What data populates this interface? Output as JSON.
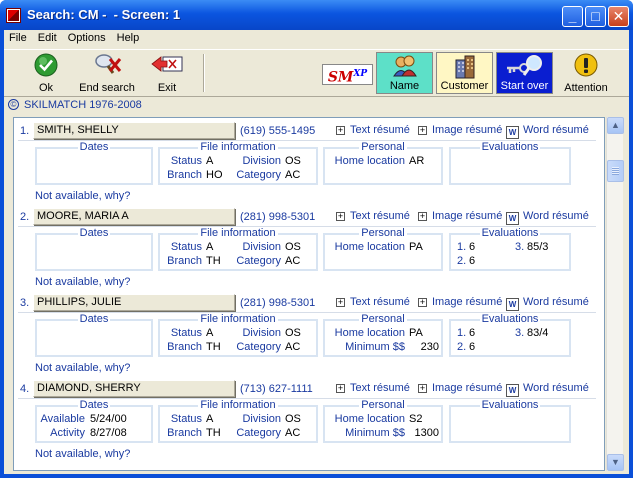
{
  "window": {
    "title": "Search: CM -  - Screen: 1",
    "controls": {
      "minimize": "_",
      "maximize": "□",
      "close": "✕"
    }
  },
  "menu": [
    "File",
    "Edit",
    "Options",
    "Help"
  ],
  "toolbar": {
    "ok": {
      "label": "Ok",
      "icon": "ok-check-icon"
    },
    "end_search": {
      "label": "End search",
      "icon": "end-search-icon"
    },
    "exit": {
      "label": "Exit",
      "icon": "exit-icon"
    },
    "logo": {
      "text": "SM",
      "sup": "XP"
    },
    "name": {
      "label": "Name",
      "icon": "people-icon",
      "color": "#5de0c8"
    },
    "customer": {
      "label": "Customer",
      "icon": "building-icon",
      "color": "#fff7c4"
    },
    "start_over": {
      "label": "Start over",
      "icon": "search-key-icon",
      "color": "#0a1ed0"
    },
    "attention": {
      "label": "Attention",
      "icon": "attention-icon"
    }
  },
  "copyright": "SKILMATCH 1976-2008",
  "links": {
    "text_resume": "Text résumé",
    "image_resume": "Image résumé",
    "word_resume": "Word résumé",
    "not_available": "Not available, why?"
  },
  "panels": {
    "dates": "Dates",
    "file_information": "File information",
    "personal": "Personal",
    "evaluations": "Evaluations"
  },
  "field_labels": {
    "status": "Status",
    "branch": "Branch",
    "division": "Division",
    "category": "Category",
    "home_location": "Home location",
    "minimum": "Minimum $$",
    "available": "Available",
    "activity": "Activity"
  },
  "records": [
    {
      "num": "1.",
      "name": "SMITH, SHELLY",
      "phone": "(619) 555-1495",
      "status": "A",
      "branch": "HO",
      "division": "OS",
      "category": "AC",
      "home_location": "AR",
      "minimum": "",
      "available": "",
      "activity": "",
      "evals": []
    },
    {
      "num": "2.",
      "name": "MOORE, MARIA A",
      "phone": "(281) 998-5301",
      "status": "A",
      "branch": "TH",
      "division": "OS",
      "category": "AC",
      "home_location": "PA",
      "minimum": "",
      "available": "",
      "activity": "",
      "evals": [
        {
          "n": "1.",
          "v": "6"
        },
        {
          "n": "3.",
          "v": "85/3"
        },
        {
          "n": "2.",
          "v": "6"
        }
      ]
    },
    {
      "num": "3.",
      "name": "PHILLIPS, JULIE",
      "phone": "(281) 998-5301",
      "status": "A",
      "branch": "TH",
      "division": "OS",
      "category": "AC",
      "home_location": "PA",
      "minimum": "230",
      "available": "",
      "activity": "",
      "evals": [
        {
          "n": "1.",
          "v": "6"
        },
        {
          "n": "3.",
          "v": "83/4"
        },
        {
          "n": "2.",
          "v": "6"
        }
      ]
    },
    {
      "num": "4.",
      "name": "DIAMOND, SHERRY",
      "phone": "(713) 627-1111",
      "status": "A",
      "branch": "TH",
      "division": "OS",
      "category": "AC",
      "home_location": "S2",
      "minimum": "1300",
      "available": "5/24/00",
      "activity": "8/27/08",
      "evals": []
    }
  ],
  "scrollbar": {
    "up": "▲",
    "down": "▼"
  }
}
